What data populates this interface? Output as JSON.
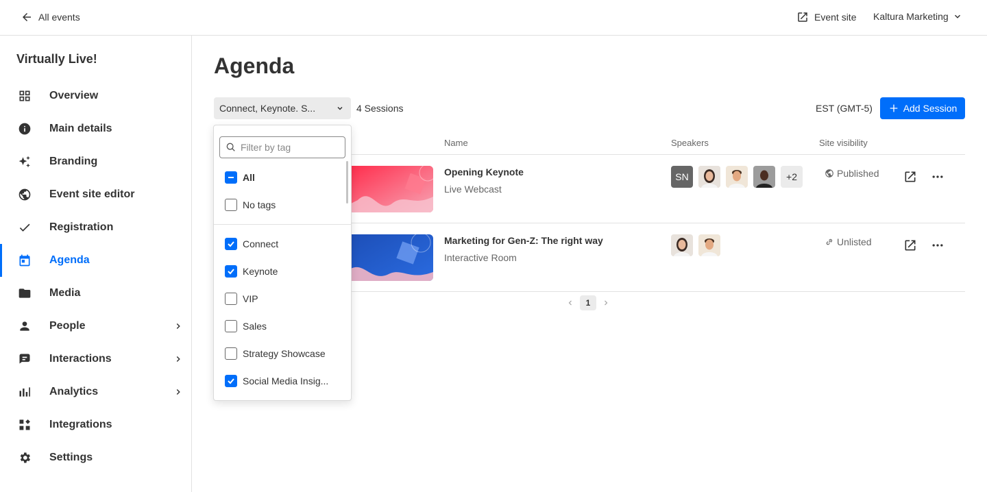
{
  "topbar": {
    "back_label": "All events",
    "event_site_label": "Event site",
    "account_label": "Kaltura Marketing"
  },
  "sidebar": {
    "app_title": "Virtually Live!",
    "items": [
      {
        "label": "Overview",
        "icon": "grid-icon"
      },
      {
        "label": "Main details",
        "icon": "info-icon"
      },
      {
        "label": "Branding",
        "icon": "sparkle-icon"
      },
      {
        "label": "Event site editor",
        "icon": "globe-icon"
      },
      {
        "label": "Registration",
        "icon": "check-icon"
      },
      {
        "label": "Agenda",
        "icon": "calendar-icon",
        "active": true
      },
      {
        "label": "Media",
        "icon": "folder-icon"
      },
      {
        "label": "People",
        "icon": "person-icon",
        "has_submenu": true
      },
      {
        "label": "Interactions",
        "icon": "chat-icon",
        "has_submenu": true
      },
      {
        "label": "Analytics",
        "icon": "bar-chart-icon",
        "has_submenu": true
      },
      {
        "label": "Integrations",
        "icon": "apps-icon"
      },
      {
        "label": "Settings",
        "icon": "gear-icon"
      }
    ]
  },
  "main": {
    "title": "Agenda",
    "tag_select_value": "Connect, Keynote. S...",
    "sessions_count": "4 Sessions",
    "timezone": "EST (GMT-5)",
    "add_session_label": "Add Session",
    "columns": {
      "name": "Name",
      "speakers": "Speakers",
      "visibility": "Site visibility"
    },
    "rows": [
      {
        "name": "Opening Keynote",
        "type": "Live Webcast",
        "speaker_initials": "SN",
        "speaker_more": "+2",
        "visibility": "Published"
      },
      {
        "name": "Marketing for Gen-Z: The right way",
        "type": "Interactive Room",
        "visibility": "Unlisted"
      }
    ],
    "pagination": {
      "current_page": "1"
    }
  },
  "dropdown": {
    "filter_placeholder": "Filter by tag",
    "options_top": [
      {
        "label": "All",
        "state": "indeterminate"
      },
      {
        "label": "No tags",
        "state": "unchecked"
      }
    ],
    "options": [
      {
        "label": "Connect",
        "state": "checked"
      },
      {
        "label": "Keynote",
        "state": "checked"
      },
      {
        "label": "VIP",
        "state": "unchecked"
      },
      {
        "label": "Sales",
        "state": "unchecked"
      },
      {
        "label": "Strategy Showcase",
        "state": "unchecked"
      },
      {
        "label": "Social Media Insig...",
        "state": "checked"
      }
    ]
  },
  "colors": {
    "accent": "#006efa",
    "text": "#333333",
    "muted": "#666666"
  }
}
